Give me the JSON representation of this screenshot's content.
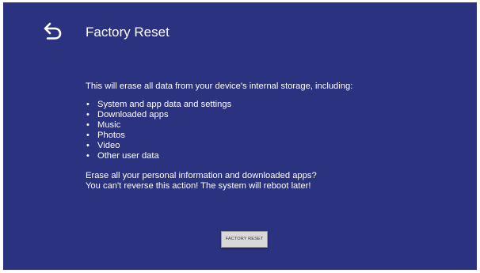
{
  "header": {
    "back_icon": "back-arrow-icon",
    "title": "Factory Reset"
  },
  "content": {
    "intro": "This will erase all data from your device's internal storage, including:",
    "bullet_glyph": "•",
    "items": [
      {
        "label": "System and app data and settings"
      },
      {
        "label": "Downloaded apps"
      },
      {
        "label": "Music"
      },
      {
        "label": "Photos"
      },
      {
        "label": "Video"
      },
      {
        "label": "Other user data"
      }
    ],
    "warning_line1": "Erase all your personal information and downloaded apps?",
    "warning_line2": "You can't reverse this action! The system will reboot later!"
  },
  "actions": {
    "factory_reset_label": "FACTORY RESET"
  },
  "colors": {
    "background": "#2b3280",
    "text": "#ffffff",
    "button_bg": "#d8d8d8",
    "button_text": "#3a3a3a"
  }
}
